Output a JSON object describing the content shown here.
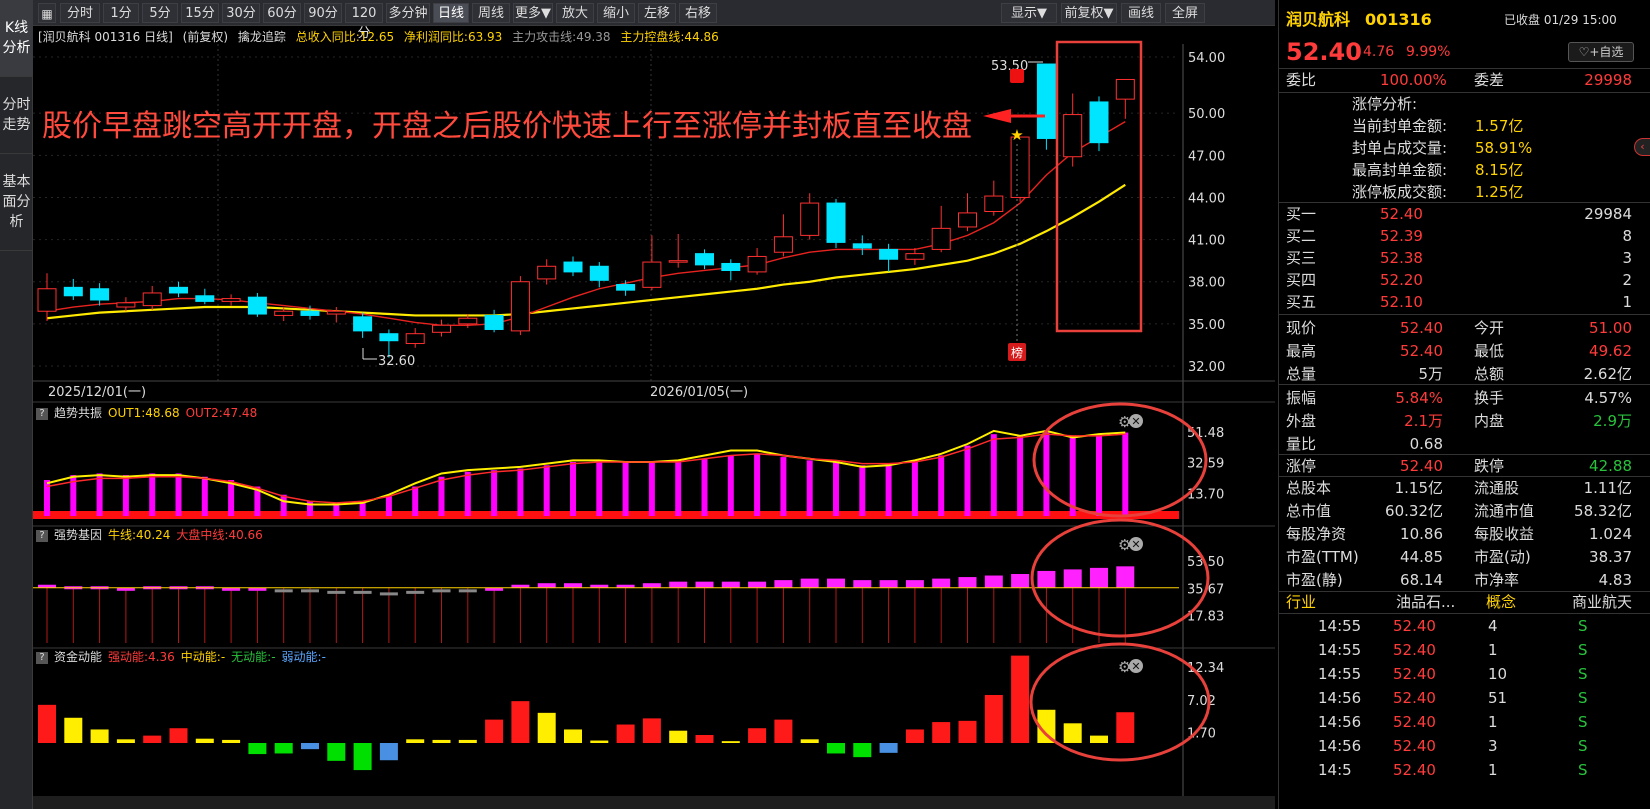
{
  "sidebar": [
    "K线分析",
    "分时走势",
    "基本面分析"
  ],
  "toolbar": {
    "left": [
      "分时",
      "1分",
      "5分",
      "15分",
      "30分",
      "60分",
      "90分",
      "120分",
      "多分钟",
      "日线",
      "周线",
      "更多▼",
      "放大",
      "缩小",
      "左移",
      "右移"
    ],
    "active": "日线",
    "right": [
      "显示▼",
      "前复权▼",
      "画线",
      "全屏"
    ]
  },
  "main_header": {
    "title": "[润贝航科 001316 日线]",
    "adj": "(前复权)",
    "ind": "擒龙追踪",
    "f1": "总收入同比:12.65",
    "f2": "净利润同比:63.93",
    "f3": "主力攻击线:49.38",
    "f4": "主力控盘线:44.86"
  },
  "annotation": "股价早盘跳空高开开盘，开盘之后股价快速上行至涨停并封板直至收盘",
  "date_labels": [
    "2025/12/01(一)",
    "2026/01/05(一)"
  ],
  "hi_label": "53.50",
  "lo_label": "32.60",
  "bang": "榜",
  "y_axis_main": [
    "54.00",
    "50.00",
    "47.00",
    "44.00",
    "41.00",
    "38.00",
    "35.00",
    "32.00"
  ],
  "p1": {
    "name": "趋势共振",
    "a": "OUT1:48.68",
    "b": "OUT2:47.48",
    "ticks": [
      "51.48",
      "32.59",
      "13.70"
    ]
  },
  "p2": {
    "name": "强势基因",
    "a": "牛线:40.24",
    "b": "大盘中线:40.66",
    "ticks": [
      "53.50",
      "35.67",
      "17.83"
    ]
  },
  "p3": {
    "name": "资金动能",
    "a": "强动能:4.36",
    "b": "中动能:-",
    "c": "无动能:-",
    "d": "弱动能:-",
    "ticks": [
      "12.34",
      "7.02",
      "1.70"
    ]
  },
  "quote": {
    "name": "润贝航科",
    "code": "001316",
    "status": "已收盘 01/29 15:00",
    "price": "52.40",
    "chg": "4.76",
    "pct": "9.99%",
    "fav": "♡+自选",
    "wb_l": "委比",
    "wb_v": "100.00%",
    "wc_l": "委差",
    "wc_v": "29998",
    "zt": [
      [
        "涨停分析:",
        ""
      ],
      [
        "当前封单金额:",
        "1.57亿"
      ],
      [
        "封单占成交量:",
        "58.91%"
      ],
      [
        "最高封单金额:",
        "8.15亿"
      ],
      [
        "涨停板成交额:",
        "1.25亿"
      ]
    ],
    "book": [
      [
        "买一",
        "52.40",
        "29984"
      ],
      [
        "买二",
        "52.39",
        "8"
      ],
      [
        "买三",
        "52.38",
        "3"
      ],
      [
        "买四",
        "52.20",
        "2"
      ],
      [
        "买五",
        "52.10",
        "1"
      ]
    ],
    "stats": [
      [
        "现价",
        "52.40",
        "今开",
        "51.00"
      ],
      [
        "最高",
        "52.40",
        "最低",
        "49.62"
      ],
      [
        "总量",
        "5万",
        "总额",
        "2.62亿"
      ]
    ],
    "stats2": [
      [
        "振幅",
        "5.84%",
        "换手",
        "4.57%"
      ],
      [
        "外盘",
        "2.1万",
        "内盘",
        "2.9万"
      ],
      [
        "量比",
        "0.68",
        "",
        ""
      ]
    ],
    "stats3": [
      [
        "涨停",
        "52.40",
        "跌停",
        "42.88"
      ]
    ],
    "stats4": [
      [
        "总股本",
        "1.15亿",
        "流通股",
        "1.11亿"
      ],
      [
        "总市值",
        "60.32亿",
        "流通市值",
        "58.32亿"
      ],
      [
        "每股净资",
        "10.86",
        "每股收益",
        "1.024"
      ],
      [
        "市盈(TTM)",
        "44.85",
        "市盈(动)",
        "38.37"
      ],
      [
        "市盈(静)",
        "68.14",
        "市净率",
        "4.83"
      ]
    ],
    "industry": [
      "行业",
      "油品石...",
      "概念",
      "商业航天"
    ],
    "ticks": [
      [
        "14:55",
        "52.40",
        "4",
        "S"
      ],
      [
        "14:55",
        "52.40",
        "1",
        "S"
      ],
      [
        "14:55",
        "52.40",
        "10",
        "S"
      ],
      [
        "14:56",
        "52.40",
        "51",
        "S"
      ],
      [
        "14:56",
        "52.40",
        "1",
        "S"
      ],
      [
        "14:56",
        "52.40",
        "3",
        "S"
      ],
      [
        "14:5",
        "52.40",
        "1",
        "S"
      ]
    ]
  },
  "chart_data": {
    "type": "candlestick",
    "candles": [
      {
        "o": 35.9,
        "c": 37.5,
        "h": 38.6,
        "l": 35.2
      },
      {
        "o": 37.6,
        "c": 37.0,
        "h": 38.2,
        "l": 36.7
      },
      {
        "o": 37.5,
        "c": 36.7,
        "h": 37.9,
        "l": 36.3
      },
      {
        "o": 36.2,
        "c": 36.5,
        "h": 36.9,
        "l": 35.9
      },
      {
        "o": 36.3,
        "c": 37.2,
        "h": 37.7,
        "l": 36.0
      },
      {
        "o": 37.6,
        "c": 37.2,
        "h": 38.0,
        "l": 36.9
      },
      {
        "o": 37.0,
        "c": 36.6,
        "h": 37.5,
        "l": 36.4
      },
      {
        "o": 36.6,
        "c": 36.8,
        "h": 37.1,
        "l": 36.3
      },
      {
        "o": 36.9,
        "c": 35.7,
        "h": 37.2,
        "l": 35.5
      },
      {
        "o": 35.6,
        "c": 35.9,
        "h": 36.2,
        "l": 35.2
      },
      {
        "o": 35.9,
        "c": 35.6,
        "h": 36.3,
        "l": 35.3
      },
      {
        "o": 35.7,
        "c": 35.9,
        "h": 36.2,
        "l": 35.1
      },
      {
        "o": 35.5,
        "c": 34.5,
        "h": 35.8,
        "l": 34.0
      },
      {
        "o": 34.3,
        "c": 33.8,
        "h": 34.6,
        "l": 32.6
      },
      {
        "o": 33.6,
        "c": 34.3,
        "h": 34.7,
        "l": 33.3
      },
      {
        "o": 34.4,
        "c": 34.9,
        "h": 35.3,
        "l": 34.1
      },
      {
        "o": 35.0,
        "c": 35.4,
        "h": 35.7,
        "l": 34.7
      },
      {
        "o": 35.6,
        "c": 34.6,
        "h": 36.0,
        "l": 34.4
      },
      {
        "o": 34.5,
        "c": 38.0,
        "h": 38.4,
        "l": 34.2
      },
      {
        "o": 38.2,
        "c": 39.1,
        "h": 39.6,
        "l": 37.8
      },
      {
        "o": 39.4,
        "c": 38.7,
        "h": 39.8,
        "l": 38.4
      },
      {
        "o": 39.1,
        "c": 38.1,
        "h": 39.4,
        "l": 37.6
      },
      {
        "o": 37.8,
        "c": 37.4,
        "h": 38.1,
        "l": 37.0
      },
      {
        "o": 37.6,
        "c": 39.4,
        "h": 41.3,
        "l": 37.4
      },
      {
        "o": 39.4,
        "c": 39.5,
        "h": 41.4,
        "l": 39.0
      },
      {
        "o": 40.0,
        "c": 39.2,
        "h": 40.3,
        "l": 38.9
      },
      {
        "o": 39.3,
        "c": 38.8,
        "h": 39.6,
        "l": 38.1
      },
      {
        "o": 38.7,
        "c": 39.8,
        "h": 40.4,
        "l": 38.5
      },
      {
        "o": 40.1,
        "c": 41.2,
        "h": 42.8,
        "l": 39.8
      },
      {
        "o": 41.3,
        "c": 43.6,
        "h": 44.3,
        "l": 41.0
      },
      {
        "o": 43.6,
        "c": 40.8,
        "h": 43.9,
        "l": 40.4
      },
      {
        "o": 40.7,
        "c": 40.4,
        "h": 41.3,
        "l": 39.9
      },
      {
        "o": 40.3,
        "c": 39.6,
        "h": 40.7,
        "l": 38.7
      },
      {
        "o": 39.6,
        "c": 40.0,
        "h": 40.4,
        "l": 39.2
      },
      {
        "o": 40.3,
        "c": 41.8,
        "h": 43.4,
        "l": 40.1
      },
      {
        "o": 41.9,
        "c": 42.9,
        "h": 44.3,
        "l": 41.6
      },
      {
        "o": 43.0,
        "c": 44.1,
        "h": 45.2,
        "l": 42.7
      },
      {
        "o": 44.0,
        "c": 48.3,
        "h": 48.3,
        "l": 43.7
      },
      {
        "o": 53.5,
        "c": 48.2,
        "h": 53.5,
        "l": 47.4
      },
      {
        "o": 46.9,
        "c": 49.9,
        "h": 51.4,
        "l": 46.2
      },
      {
        "o": 50.8,
        "c": 47.9,
        "h": 51.2,
        "l": 47.3
      },
      {
        "o": 51.0,
        "c": 52.4,
        "h": 52.4,
        "l": 49.6
      }
    ],
    "ma_red": [
      35.9,
      36.2,
      36.4,
      36.5,
      36.6,
      36.8,
      36.8,
      36.7,
      36.5,
      36.3,
      36.1,
      35.9,
      35.7,
      35.4,
      35.1,
      34.9,
      34.9,
      35.0,
      35.5,
      36.2,
      36.9,
      37.5,
      37.9,
      38.3,
      38.6,
      38.8,
      39.0,
      39.2,
      39.7,
      40.1,
      40.3,
      40.3,
      40.3,
      40.3,
      40.7,
      41.3,
      42.2,
      43.6,
      45.6,
      47.2,
      48.3,
      49.4
    ],
    "ma_yel": [
      35.4,
      35.6,
      35.8,
      35.9,
      36.0,
      36.1,
      36.2,
      36.2,
      36.2,
      36.1,
      36.0,
      35.9,
      35.8,
      35.7,
      35.6,
      35.6,
      35.6,
      35.6,
      35.7,
      35.9,
      36.1,
      36.3,
      36.5,
      36.7,
      36.9,
      37.1,
      37.3,
      37.5,
      37.8,
      38.0,
      38.3,
      38.5,
      38.7,
      38.9,
      39.2,
      39.5,
      40.0,
      40.7,
      41.6,
      42.6,
      43.7,
      44.9
    ],
    "p1_bars": [
      22,
      25,
      26,
      25,
      26,
      26,
      24,
      22,
      18,
      13,
      9,
      8,
      9,
      12,
      18,
      24,
      27,
      28,
      29,
      31,
      33,
      34,
      33,
      33,
      34,
      35,
      37,
      38,
      36,
      34,
      33,
      31,
      32,
      34,
      37,
      43,
      50,
      49,
      51,
      48,
      50,
      51
    ],
    "p1_line_y": [
      20,
      24,
      25,
      24,
      25,
      25,
      23,
      20,
      16,
      9,
      7,
      7,
      8,
      13,
      20,
      26,
      28,
      29,
      30,
      32,
      34,
      34,
      33,
      33,
      34,
      37,
      40,
      40,
      37,
      35,
      33,
      30,
      31,
      34,
      38,
      44,
      52,
      49,
      52,
      48,
      50,
      51
    ],
    "p1_line_r": [
      18,
      21,
      23,
      23,
      24,
      24,
      23,
      21,
      17,
      12,
      9,
      8,
      9,
      12,
      17,
      22,
      25,
      27,
      28,
      30,
      32,
      33,
      33,
      33,
      33,
      35,
      37,
      38,
      37,
      35,
      34,
      32,
      32,
      33,
      36,
      41,
      47,
      48,
      50,
      49,
      49,
      50
    ],
    "p2_tops": [
      38,
      37,
      37,
      36,
      37,
      37,
      37,
      36,
      36,
      35,
      35,
      34,
      34,
      33,
      34,
      35,
      35,
      36,
      38,
      39,
      39,
      38,
      38,
      39,
      40,
      40,
      40,
      40,
      41,
      42,
      42,
      41,
      41,
      41,
      42,
      43,
      44,
      45,
      47,
      48,
      49,
      50
    ],
    "p3_vals": [
      6.2,
      4.1,
      2.2,
      0.6,
      1.2,
      2.4,
      0.7,
      0.5,
      -1.8,
      -1.7,
      -1.0,
      -2.9,
      -4.4,
      -2.8,
      0.6,
      0.5,
      0.5,
      3.8,
      6.8,
      4.9,
      2.2,
      0.4,
      3.0,
      4.0,
      2.0,
      1.3,
      0.3,
      2.4,
      3.8,
      0.6,
      -1.7,
      -2.3,
      -1.6,
      2.2,
      3.4,
      3.6,
      7.8,
      14.2,
      5.4,
      3.2,
      1.2,
      5.0
    ],
    "p3_col": [
      "r",
      "y",
      "y",
      "y",
      "r",
      "r",
      "y",
      "y",
      "g",
      "g",
      "b",
      "g",
      "g",
      "b",
      "y",
      "y",
      "y",
      "r",
      "r",
      "y",
      "y",
      "y",
      "r",
      "r",
      "y",
      "r",
      "y",
      "r",
      "r",
      "y",
      "g",
      "g",
      "b",
      "r",
      "r",
      "r",
      "r",
      "r",
      "y",
      "y",
      "y",
      "r"
    ]
  }
}
